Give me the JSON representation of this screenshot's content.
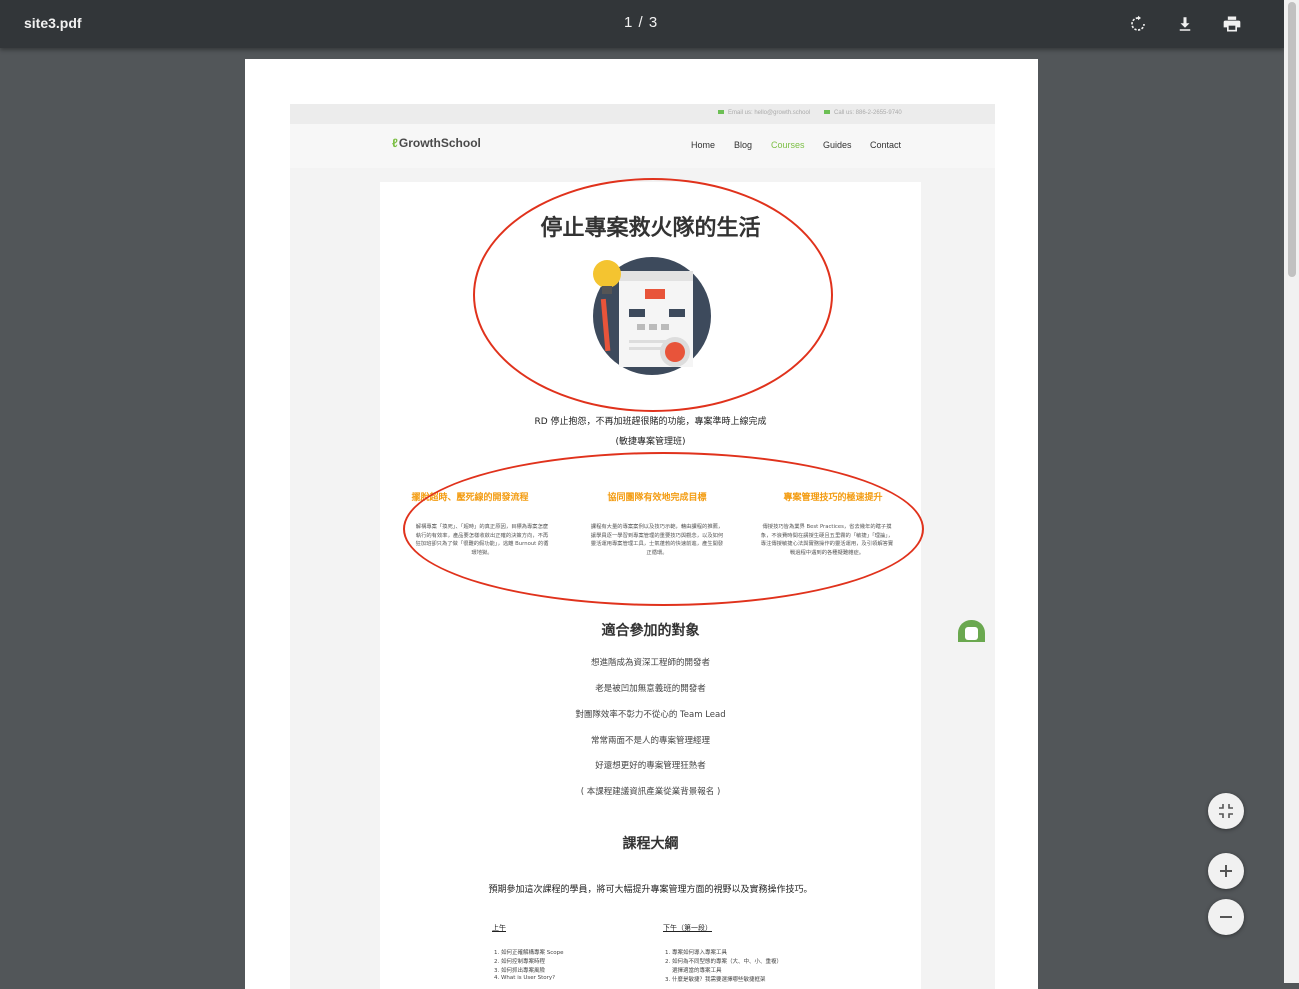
{
  "toolbar": {
    "file_name": "site3.pdf",
    "page_indicator": "1 / 3",
    "icons": [
      "rotate-icon",
      "download-icon",
      "print-icon"
    ]
  },
  "site": {
    "contact_email": "Email us: hello@growth.school",
    "contact_phone": "Call us: 886-2-2655-9740",
    "logo": "GrowthSchool",
    "nav": [
      "Home",
      "Blog",
      "Courses",
      "Guides",
      "Contact"
    ],
    "active_nav": "Courses",
    "accent_color": "#7cbf45"
  },
  "hero": {
    "title": "停止專案救火隊的生活",
    "subtitle": "RD 停止抱怨，不再加班趕很賭的功能，專案準時上線完成",
    "course_name": "(敏捷專案管理班)"
  },
  "features": [
    {
      "title": "擺脫超時、壓死線的開發流程",
      "body": "解構專案「換死」、「超時」的真正原因，目標為專案怎麼執行的有效率，產品要怎樣收斂出正確的決策方向，不再狂加班卻只為了做「很難的假功能」，逃離 Burnout 的循環地獄。"
    },
    {
      "title": "協同團隊有效地完成目標",
      "body": "課程有大量的專案案例以及技巧示範，藉由課程的推薦，讓學員逐一學習到專案管理的重要技巧與觀念，以及如何靈活運用專案管理工具，士氣蓬勃的快速前進，產生開發正循環。"
    },
    {
      "title": "專案管理技巧的極速提升",
      "body": "傳授技巧皆為業界 Best Practices，省去幾年的瞎子摸象，不浪費時間在講授生硬且五里霧的「敏捷」「理論」，專注傳授敏捷心法與實務操作的靈活運用，及引領解答實戰過程中遇到的各種疑難雜症。"
    }
  ],
  "audience": {
    "heading": "適合參加的對象",
    "items": [
      "想進階成為資深工程師的開發者",
      "老是被凹加無意義班的開發者",
      "對團隊效率不彰力不從心的 Team Lead",
      "常常兩面不是人的專案管理經理",
      "好還想更好的專案管理狂熱者",
      "( 本課程建議資訊產業從業背景報名 )"
    ]
  },
  "syllabus": {
    "heading": "課程大綱",
    "intro": "預期參加這次課程的學員，將可大幅提升專案管理方面的視野以及實務操作技巧。",
    "morning_heading": "上午",
    "morning": [
      "1. 如何正確解構專案 Scope",
      "2. 如何控制專案時程",
      "3. 如何抓出專案風險",
      "4. What is User Story?"
    ],
    "afternoon_heading": "下午（第一段）",
    "afternoon": [
      "1. 專案如何導入專案工具",
      "2. 如何為不同型態的專案（大、中、小、重複）",
      "    選擇適當的專案工具",
      "3. 什麼是敏捷？我需要選擇哪些敏捷框架"
    ]
  },
  "annotation_color": "#e0321c"
}
